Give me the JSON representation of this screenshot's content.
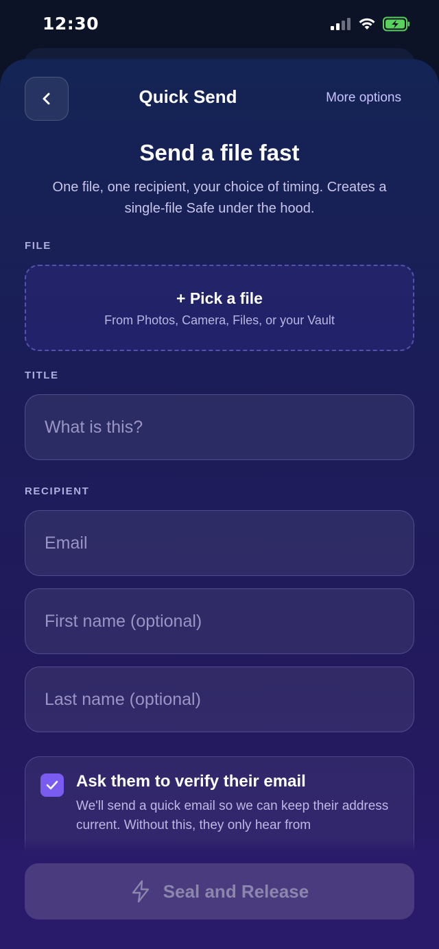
{
  "status_bar": {
    "time": "12:30",
    "icons": [
      "cellular-signal-icon",
      "wifi-icon",
      "battery-charging-icon"
    ]
  },
  "nav": {
    "title": "Quick Send",
    "more_options": "More options",
    "back_icon": "chevron-left-icon"
  },
  "header": {
    "title": "Send a file fast",
    "subtitle": "One file, one recipient, your choice of timing. Creates a single-file Safe under the hood."
  },
  "file": {
    "label": "FILE",
    "pick_label": "+ Pick a file",
    "pick_hint": "From Photos, Camera, Files, or your Vault"
  },
  "title_field": {
    "label": "TITLE",
    "placeholder": "What is this?",
    "value": ""
  },
  "recipient": {
    "label": "RECIPIENT",
    "email_placeholder": "Email",
    "first_name_placeholder": "First name (optional)",
    "last_name_placeholder": "Last name (optional)"
  },
  "verify": {
    "checked": true,
    "title": "Ask them to verify their email",
    "description": "We'll send a quick email so we can keep their address current. Without this, they only hear from"
  },
  "action": {
    "label": "Seal and Release",
    "icon": "lightning-bolt-icon"
  },
  "colors": {
    "accent": "#7a5cf0",
    "link": "#c9c3ff",
    "background_top": "#142454",
    "background_bottom": "#2a1a6a"
  }
}
